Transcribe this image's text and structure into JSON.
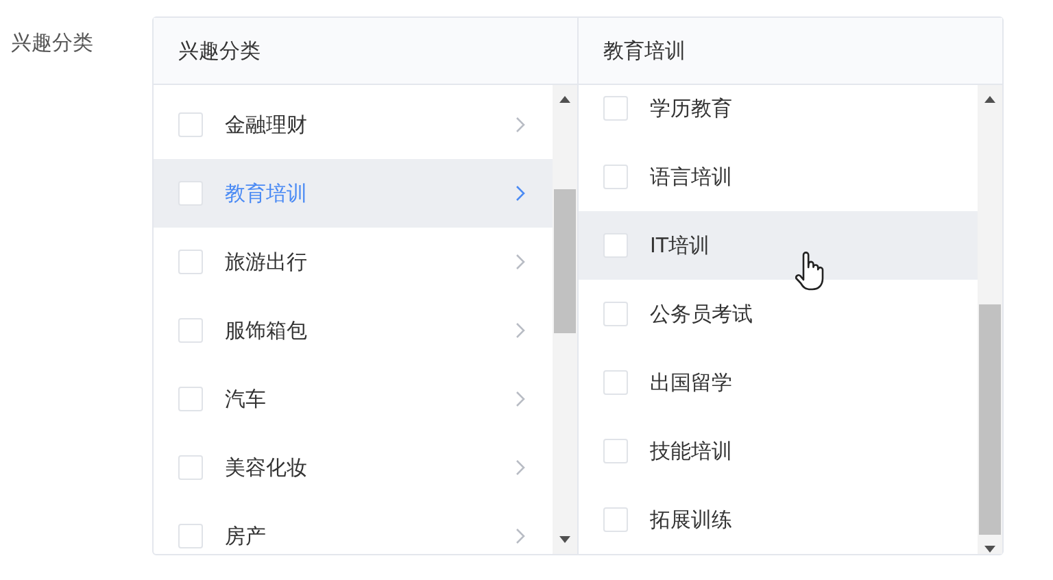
{
  "field_label": "兴趣分类",
  "columns": [
    {
      "title": "兴趣分类",
      "items": [
        {
          "label": "金融理财",
          "checked": false,
          "selected": false,
          "hovered": false,
          "has_children": true
        },
        {
          "label": "教育培训",
          "checked": false,
          "selected": true,
          "hovered": true,
          "has_children": true
        },
        {
          "label": "旅游出行",
          "checked": false,
          "selected": false,
          "hovered": false,
          "has_children": true
        },
        {
          "label": "服饰箱包",
          "checked": false,
          "selected": false,
          "hovered": false,
          "has_children": true
        },
        {
          "label": "汽车",
          "checked": false,
          "selected": false,
          "hovered": false,
          "has_children": true
        },
        {
          "label": "美容化妆",
          "checked": false,
          "selected": false,
          "hovered": false,
          "has_children": true
        },
        {
          "label": "房产",
          "checked": false,
          "selected": false,
          "hovered": false,
          "has_children": true
        }
      ]
    },
    {
      "title": "教育培训",
      "items": [
        {
          "label": "学历教育",
          "checked": false,
          "selected": false,
          "hovered": false,
          "has_children": false
        },
        {
          "label": "语言培训",
          "checked": false,
          "selected": false,
          "hovered": false,
          "has_children": false
        },
        {
          "label": "IT培训",
          "checked": false,
          "selected": false,
          "hovered": true,
          "has_children": false
        },
        {
          "label": "公务员考试",
          "checked": false,
          "selected": false,
          "hovered": false,
          "has_children": false
        },
        {
          "label": "出国留学",
          "checked": false,
          "selected": false,
          "hovered": false,
          "has_children": false
        },
        {
          "label": "技能培训",
          "checked": false,
          "selected": false,
          "hovered": false,
          "has_children": false
        },
        {
          "label": "拓展训练",
          "checked": false,
          "selected": false,
          "hovered": false,
          "has_children": false
        }
      ]
    }
  ]
}
